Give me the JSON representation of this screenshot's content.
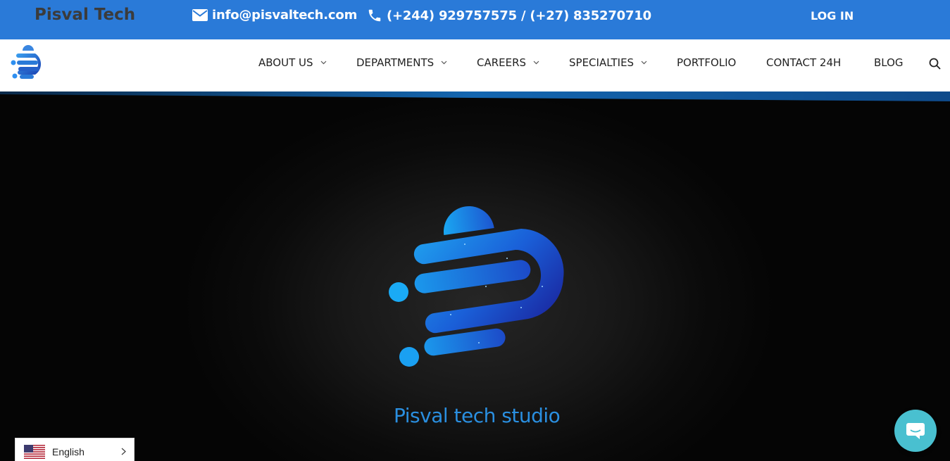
{
  "topbar": {
    "brand": "Pisval Tech",
    "email": "info@pisvaltech.com",
    "phone": "(+244) 929757575 / (+27) 835270710",
    "login_label": "LOG IN",
    "email_icon": "envelope-icon",
    "phone_icon": "phone-icon"
  },
  "nav": {
    "items": [
      {
        "label": "ABOUT US",
        "has_dropdown": true
      },
      {
        "label": "DEPARTMENTS",
        "has_dropdown": true
      },
      {
        "label": "CAREERS",
        "has_dropdown": true
      },
      {
        "label": "SPECIALTIES",
        "has_dropdown": true
      },
      {
        "label": "PORTFOLIO",
        "has_dropdown": false
      },
      {
        "label": "CONTACT 24H",
        "has_dropdown": false
      },
      {
        "label": "BLOG",
        "has_dropdown": false
      }
    ],
    "search_icon": "search-icon"
  },
  "hero": {
    "title": "Pisval tech studio"
  },
  "language": {
    "selected": "English",
    "flag_icon": "us-flag-icon"
  },
  "chat": {
    "icon": "chat-bubble-icon"
  },
  "colors": {
    "topbar_bg": "#2a7ad8",
    "brand_text": "#3b3b3b",
    "hero_title": "#2a8fe0",
    "chat_bg": "#49c0d0"
  }
}
